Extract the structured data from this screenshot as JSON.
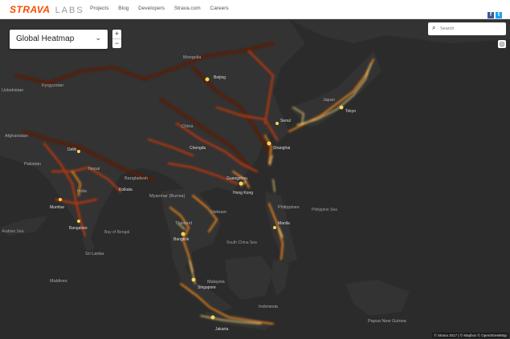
{
  "header": {
    "brand": "STRAVA",
    "labs": "LABS",
    "nav": [
      "Projects",
      "Blog",
      "Developers",
      "Strava.com",
      "Careers"
    ],
    "social": [
      {
        "name": "facebook-icon",
        "glyph": "f"
      },
      {
        "name": "twitter-icon",
        "glyph": "t"
      }
    ]
  },
  "controls": {
    "heatmap_label": "Global Heatmap",
    "zoom_in": "+",
    "zoom_out": "−",
    "search_placeholder": "Search",
    "search_icon": "search-icon",
    "locate_icon": "locate-icon"
  },
  "attribution": "© Strava 2017 | © Mapbox © OpenStreetMap",
  "map_labels": [
    {
      "text": "Mongolia",
      "type": "country"
    },
    {
      "text": "Uzbekistan",
      "type": "country"
    },
    {
      "text": "Kyrgyzstan",
      "type": "country"
    },
    {
      "text": "Afghanistan",
      "type": "country"
    },
    {
      "text": "Pakistan",
      "type": "country"
    },
    {
      "text": "China",
      "type": "country"
    },
    {
      "text": "Japan",
      "type": "country"
    },
    {
      "text": "India",
      "type": "country"
    },
    {
      "text": "Nepal",
      "type": "country"
    },
    {
      "text": "Bangladesh",
      "type": "country"
    },
    {
      "text": "Myanmar (Burma)",
      "type": "country"
    },
    {
      "text": "Thailand",
      "type": "country"
    },
    {
      "text": "Vietnam",
      "type": "country"
    },
    {
      "text": "Philippines",
      "type": "country"
    },
    {
      "text": "Malaysia",
      "type": "country"
    },
    {
      "text": "Indonesia",
      "type": "country"
    },
    {
      "text": "Papua New Guinea",
      "type": "country"
    },
    {
      "text": "Sri Lanka",
      "type": "country"
    },
    {
      "text": "Maldives",
      "type": "country"
    },
    {
      "text": "Arabian Sea",
      "type": "sea"
    },
    {
      "text": "Bay of Bengal",
      "type": "sea"
    },
    {
      "text": "Philippine Sea",
      "type": "sea"
    },
    {
      "text": "South China Sea",
      "type": "sea"
    },
    {
      "text": "Beijing",
      "type": "city"
    },
    {
      "text": "Shanghai",
      "type": "city"
    },
    {
      "text": "Chengdu",
      "type": "city"
    },
    {
      "text": "Guangzhou",
      "type": "city"
    },
    {
      "text": "Hong Kong",
      "type": "city"
    },
    {
      "text": "Seoul",
      "type": "city"
    },
    {
      "text": "Tokyo",
      "type": "city"
    },
    {
      "text": "Delhi",
      "type": "city"
    },
    {
      "text": "Mumbai",
      "type": "city"
    },
    {
      "text": "Bangalore",
      "type": "city"
    },
    {
      "text": "Kolkata",
      "type": "city"
    },
    {
      "text": "Bangkok",
      "type": "city"
    },
    {
      "text": "Manila",
      "type": "city"
    },
    {
      "text": "Singapore",
      "type": "city"
    },
    {
      "text": "Jakarta",
      "type": "city"
    }
  ]
}
